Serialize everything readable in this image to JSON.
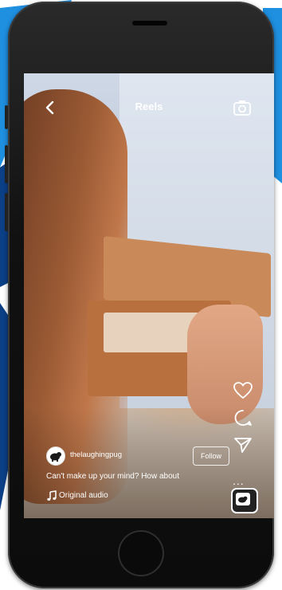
{
  "reels": {
    "title": "Reels",
    "back_icon": "chevron-left-icon",
    "camera_icon": "camera-icon"
  },
  "post": {
    "username": "thelaughingpug",
    "follow_label": "Follow",
    "caption": "Can't make up your mind? How about",
    "audio_label": "Original audio"
  },
  "actions": {
    "like_icon": "heart-icon",
    "comment_icon": "comment-icon",
    "share_icon": "send-icon",
    "more_label": "...",
    "more_icon": "more-icon"
  },
  "colors": {
    "ui_text": "#ffffff",
    "phone_body": "#111111",
    "background_accent": "#1f8fe0",
    "background_accent_dark": "#0b3f86"
  }
}
